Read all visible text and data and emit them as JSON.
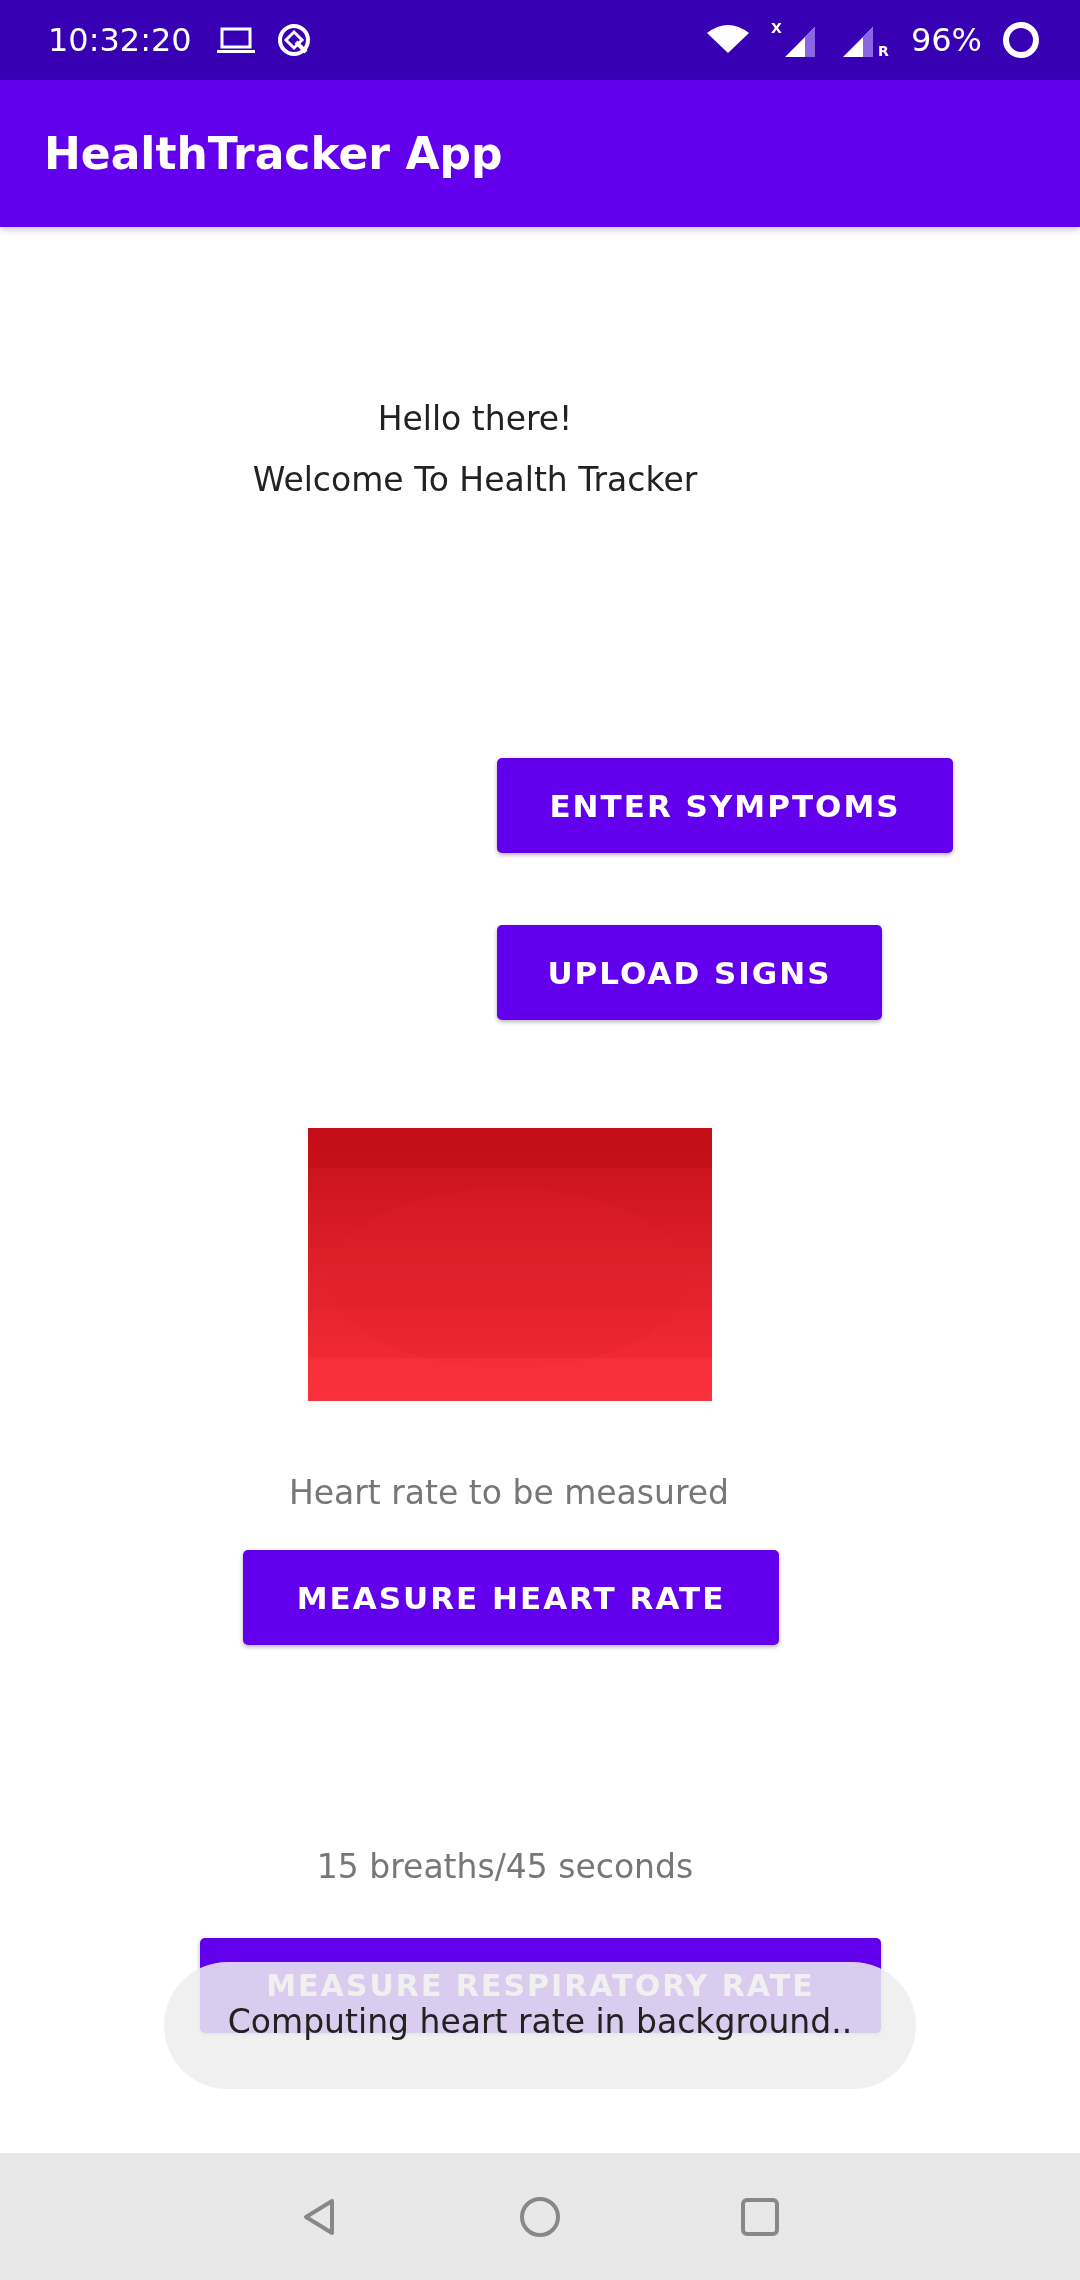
{
  "status_bar": {
    "time": "10:32:20",
    "signal_badge": "X",
    "roaming_badge": "R",
    "battery": "96%"
  },
  "app_bar": {
    "title": "HealthTracker App"
  },
  "greeting": {
    "line_1": "Hello there!",
    "line_2": "Welcome To Health Tracker"
  },
  "actions": [
    {
      "label": "ENTER SYMPTOMS"
    },
    {
      "label": "UPLOAD SIGNS"
    }
  ],
  "heart_rate": {
    "status": "Heart rate to be measured",
    "button": "MEASURE HEART RATE"
  },
  "respiratory_rate": {
    "status": "15 breaths/45 seconds",
    "button": "MEASURE RESPIRATORY RATE"
  },
  "toast": {
    "message": "Computing heart rate in background.."
  }
}
